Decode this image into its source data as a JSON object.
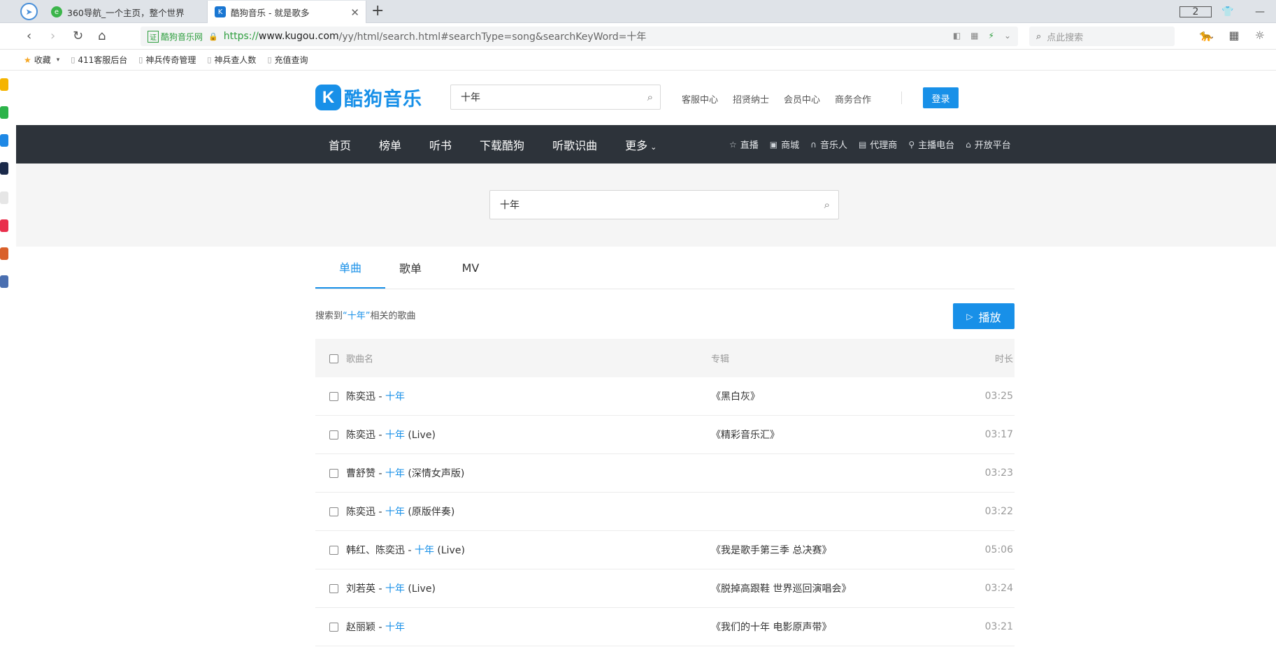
{
  "browser": {
    "tabs": [
      {
        "title": "360导航_一个主页，整个世界"
      },
      {
        "title": "酷狗音乐 - 就是歌多"
      }
    ],
    "tab_count": "2",
    "url": {
      "site_badge": "酷狗音乐网",
      "https": "https://",
      "host": "www.kugou.com",
      "path": "/yy/html/search.html#searchType=song&searchKeyWord=十年"
    },
    "search_placeholder": "点此搜索",
    "bookmarks": [
      "收藏",
      "411客服后台",
      "神兵传奇管理",
      "神兵查人数",
      "充值查询"
    ]
  },
  "header": {
    "logo_text": "酷狗音乐",
    "search_value": "十年",
    "links": [
      "客服中心",
      "招贤纳士",
      "会员中心",
      "商务合作"
    ],
    "login": "登录"
  },
  "nav": {
    "main": [
      "首页",
      "榜单",
      "听书",
      "下载酷狗",
      "听歌识曲",
      "更多"
    ],
    "sub": [
      "直播",
      "商城",
      "音乐人",
      "代理商",
      "主播电台",
      "开放平台"
    ]
  },
  "search_band": {
    "value": "十年"
  },
  "result_tabs": [
    "单曲",
    "歌单",
    "MV"
  ],
  "result": {
    "prefix": "搜索到",
    "keyword": "“十年”",
    "suffix": "相关的歌曲",
    "play": "播放"
  },
  "table": {
    "headers": {
      "name": "歌曲名",
      "album": "专辑",
      "duration": "时长"
    },
    "rows": [
      {
        "artist": "陈奕迅 - ",
        "title": "十年",
        "extra": "",
        "album": "《黑白灰》",
        "duration": "03:25"
      },
      {
        "artist": "陈奕迅 - ",
        "title": "十年",
        "extra": " (Live)",
        "album": "《精彩音乐汇》",
        "duration": "03:17"
      },
      {
        "artist": "曹舒赞 - ",
        "title": "十年",
        "extra": " (深情女声版)",
        "album": "",
        "duration": "03:23"
      },
      {
        "artist": "陈奕迅 - ",
        "title": "十年",
        "extra": " (原版伴奏)",
        "album": "",
        "duration": "03:22"
      },
      {
        "artist": "韩红、陈奕迅 - ",
        "title": "十年",
        "extra": " (Live)",
        "album": "《我是歌手第三季 总决赛》",
        "duration": "05:06"
      },
      {
        "artist": "刘若英 - ",
        "title": "十年",
        "extra": " (Live)",
        "album": "《脱掉高跟鞋 世界巡回演唱会》",
        "duration": "03:24"
      },
      {
        "artist": "赵丽颖 - ",
        "title": "十年",
        "extra": "",
        "album": "《我们的十年 电影原声带》",
        "duration": "03:21"
      }
    ]
  },
  "colors": {
    "accent": "#1890e8",
    "navbar": "#2d333a"
  }
}
